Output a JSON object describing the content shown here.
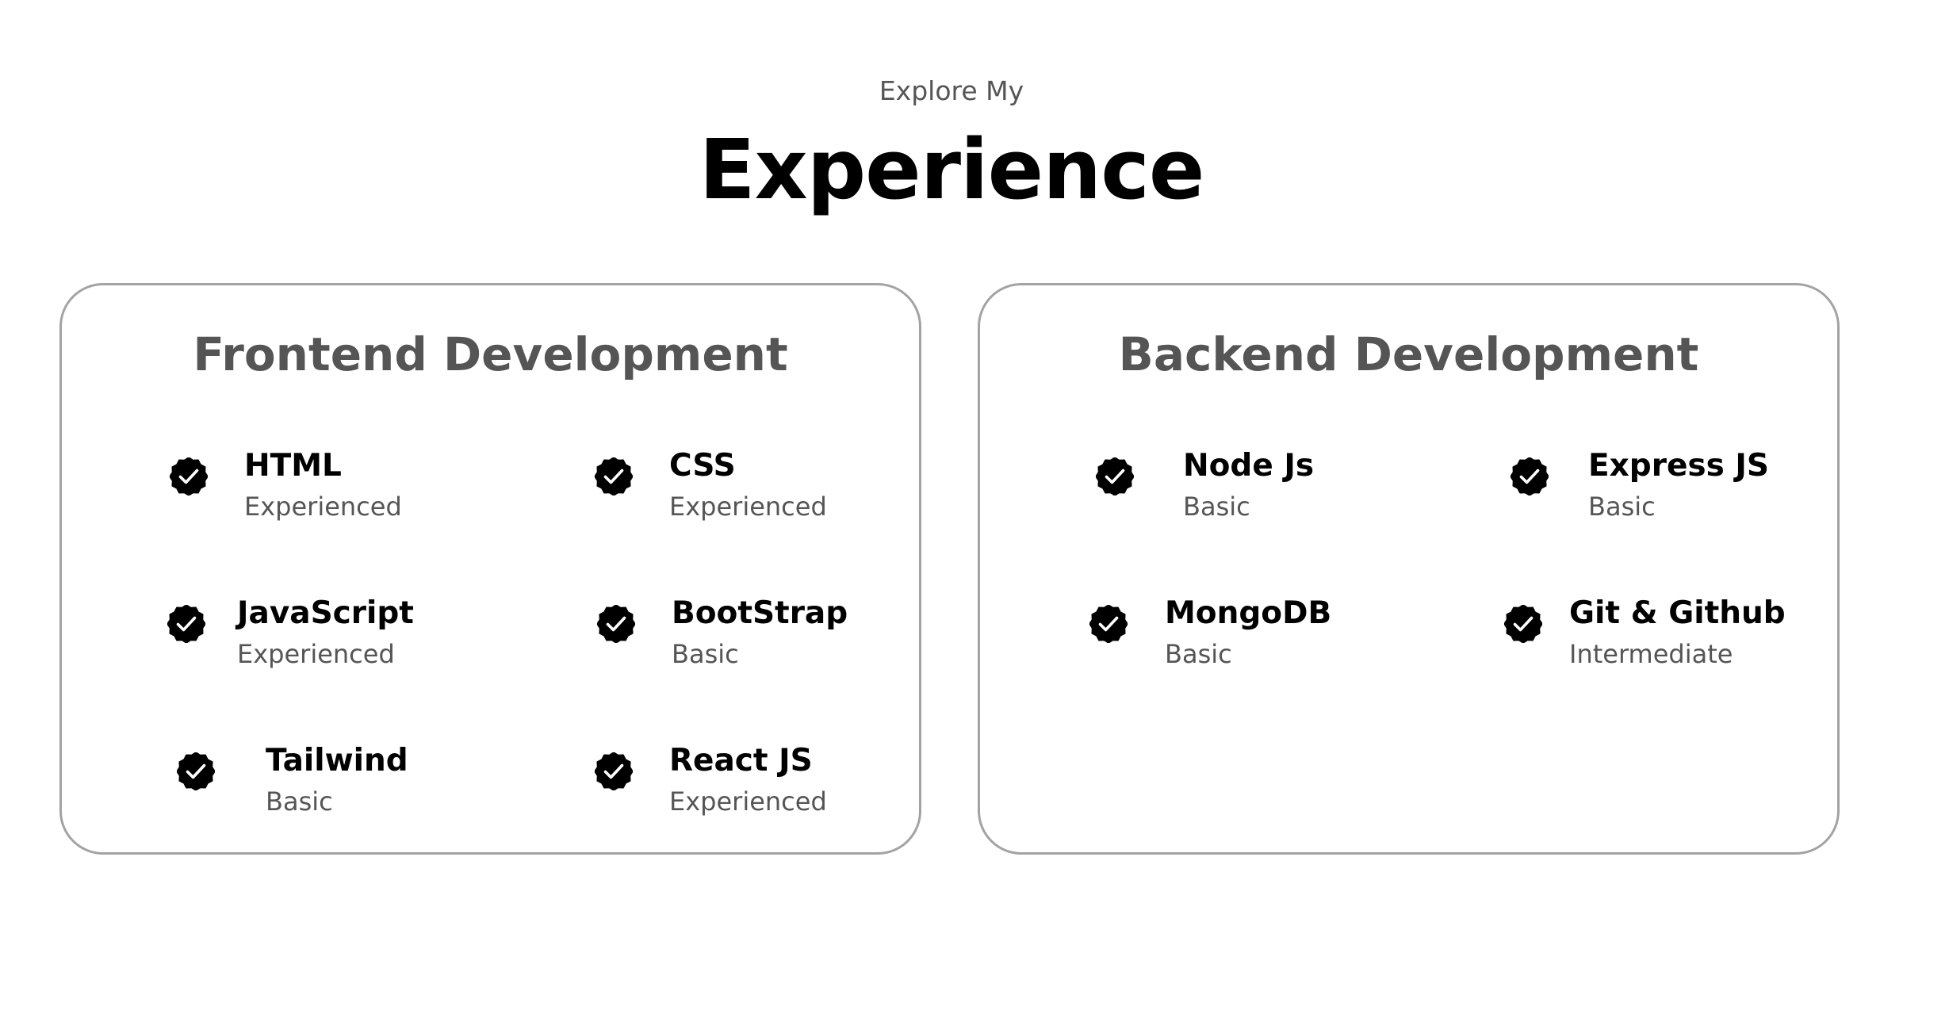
{
  "header": {
    "eyebrow": "Explore My",
    "title": "Experience"
  },
  "frontend": {
    "title": "Frontend Development",
    "skills": [
      {
        "name": "HTML",
        "level": "Experienced",
        "icon": "check-badge-icon"
      },
      {
        "name": "CSS",
        "level": "Experienced",
        "icon": "check-badge-icon"
      },
      {
        "name": "JavaScript",
        "level": "Experienced",
        "icon": "check-badge-icon"
      },
      {
        "name": "BootStrap",
        "level": "Basic",
        "icon": "check-badge-icon"
      },
      {
        "name": "Tailwind",
        "level": "Basic",
        "icon": "check-badge-icon"
      },
      {
        "name": "React JS",
        "level": "Experienced",
        "icon": "check-badge-icon"
      }
    ]
  },
  "backend": {
    "title": "Backend Development",
    "skills": [
      {
        "name": "Node Js",
        "level": "Basic",
        "icon": "check-badge-icon"
      },
      {
        "name": "Express JS",
        "level": "Basic",
        "icon": "check-badge-icon"
      },
      {
        "name": "MongoDB",
        "level": "Basic",
        "icon": "check-badge-icon"
      },
      {
        "name": "Git & Github",
        "level": "Intermediate",
        "icon": "check-badge-icon"
      }
    ]
  },
  "colors": {
    "text_primary": "#000000",
    "text_secondary": "#555555",
    "card_border": "#a3a3a3"
  }
}
